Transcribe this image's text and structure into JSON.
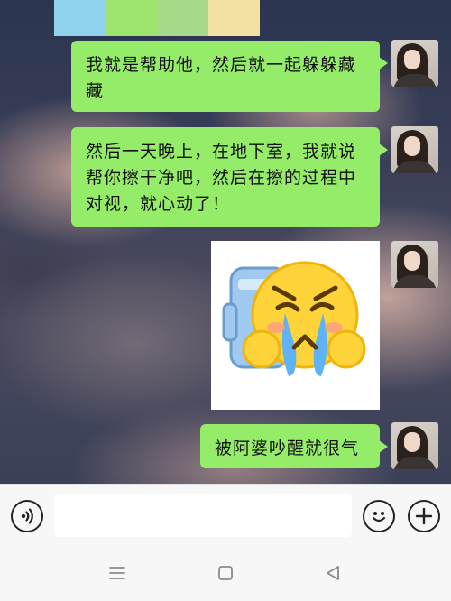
{
  "colors": {
    "bubble": "#95ec69",
    "strip": [
      "#8fd3ee",
      "#9de56f",
      "#a7d98a",
      "#f2e1a0"
    ]
  },
  "messages": [
    {
      "type": "text",
      "text": "我就是帮助他，然后就一起躲躲藏藏"
    },
    {
      "type": "text",
      "text": "然后一天晚上，在地下室，我就说帮你擦干净吧，然后在擦的过程中对视，就心动了！"
    },
    {
      "type": "sticker",
      "icon": "crying-emoji-sticker"
    },
    {
      "type": "text",
      "text": "被阿婆吵醒就很气"
    }
  ],
  "input_bar": {
    "voice_icon": "voice-icon",
    "placeholder": "",
    "emoji_icon": "smiley-icon",
    "more_icon": "plus-icon"
  },
  "nav_bar": {
    "icons": [
      "menu-icon",
      "home-square-icon",
      "back-triangle-icon"
    ]
  }
}
